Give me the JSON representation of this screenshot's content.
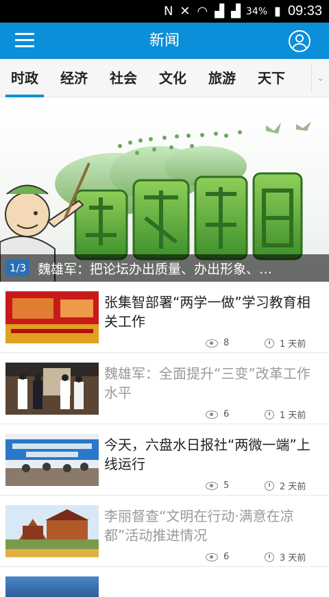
{
  "status_bar": {
    "icons": [
      "n-icon",
      "mute-icon",
      "wifi-icon",
      "signal1-icon",
      "signal2-icon"
    ],
    "battery_percent": "34%",
    "time": "09:33"
  },
  "header": {
    "title": "新闻"
  },
  "tabs": [
    {
      "label": "时政",
      "active": true
    },
    {
      "label": "经济",
      "active": false
    },
    {
      "label": "社会",
      "active": false
    },
    {
      "label": "文化",
      "active": false
    },
    {
      "label": "旅游",
      "active": false
    },
    {
      "label": "天下",
      "active": false
    }
  ],
  "banner": {
    "index": "1/3",
    "headline": "魏雄军：把论坛办出质量、办出形象、…"
  },
  "news": [
    {
      "title": "张集智部署“两学一做”学习教育相关工作",
      "views": "8",
      "time": "1 天前",
      "read": false
    },
    {
      "title": "魏雄军：全面提升“三变”改革工作水平",
      "views": "6",
      "time": "1 天前",
      "read": true
    },
    {
      "title": "今天，六盘水日报社“两微一端”上线运行",
      "views": "5",
      "time": "2 天前",
      "read": false
    },
    {
      "title": "李丽督查“文明在行动·满意在凉都”活动推进情况",
      "views": "6",
      "time": "3 天前",
      "read": true
    }
  ],
  "colors": {
    "brand": "#0a8fd8",
    "status_bar": "#000000",
    "tab_bg": "#f6f6f6",
    "read_title": "#9a9a9a"
  }
}
